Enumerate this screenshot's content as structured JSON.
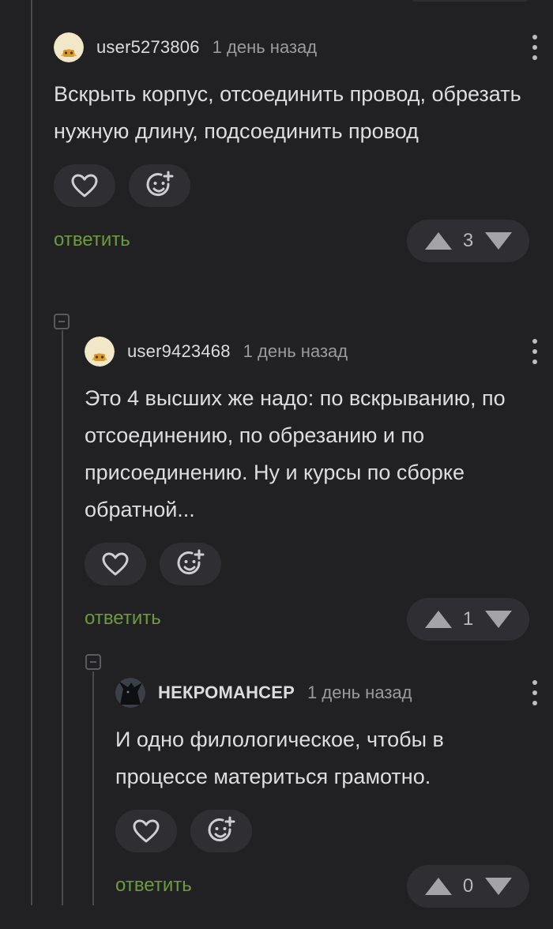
{
  "comments": [
    {
      "username": "user5273806",
      "time": "1 день назад",
      "text": "Вскрыть корпус, отсоединить провод, обрезать нужную длину, подсоединить провод",
      "reply_label": "ответить",
      "rating": "3",
      "avatar": "default-avatar-icon"
    },
    {
      "username": "user9423468",
      "time": "1 день назад",
      "text": "Это 4 высших же надо: по вскрыванию, по отсоединению, по обрезанию и по присоединению. Ну и курсы по сборке обратной...",
      "reply_label": "ответить",
      "rating": "1",
      "avatar": "default-avatar-icon"
    },
    {
      "username": "НЕКРОМАНСЕР",
      "time": "1 день назад",
      "text": "И одно филологическое, чтобы в процессе материться грамотно.",
      "reply_label": "ответить",
      "rating": "0",
      "avatar": "dark-creature-avatar"
    }
  ],
  "colors": {
    "background": "#212124",
    "button_bg": "#2f2f33",
    "reply_green": "#6c9b3d",
    "thread_line": "#4a4a4f"
  }
}
